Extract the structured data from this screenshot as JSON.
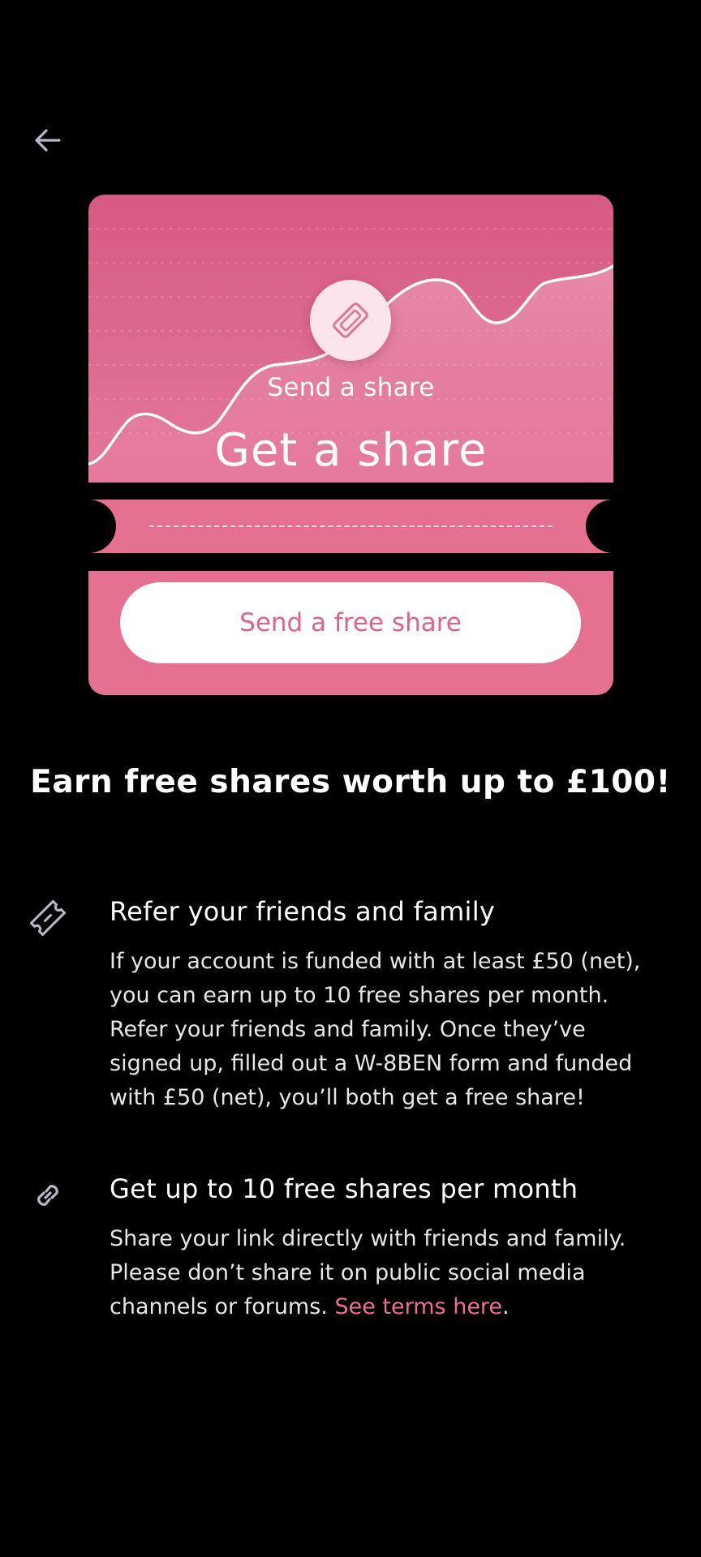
{
  "nav": {
    "back_icon": "arrow-left-icon"
  },
  "ticket": {
    "icon": "ticket-icon",
    "subtitle": "Send a share",
    "title": "Get a share",
    "button_label": "Send a free share",
    "colors": {
      "accent": "#e5708f",
      "button_text": "#e0628a"
    }
  },
  "headline": "Earn free shares worth up to £100!",
  "info": [
    {
      "icon": "ticket-outline-icon",
      "title": "Refer your friends and family",
      "body": "If your account is funded with at least £50 (net), you can earn up to 10 free shares per month. Refer your friends and family. Once they’ve signed up, filled out a W-8BEN form and funded with £50 (net), you’ll both get a free share!"
    },
    {
      "icon": "link-icon",
      "title": "Get up to 10 free shares per month",
      "body": "Share your link directly with friends and family. Please don’t share it on public social media channels or forums.",
      "link_text": "See terms here",
      "suffix": "."
    }
  ]
}
